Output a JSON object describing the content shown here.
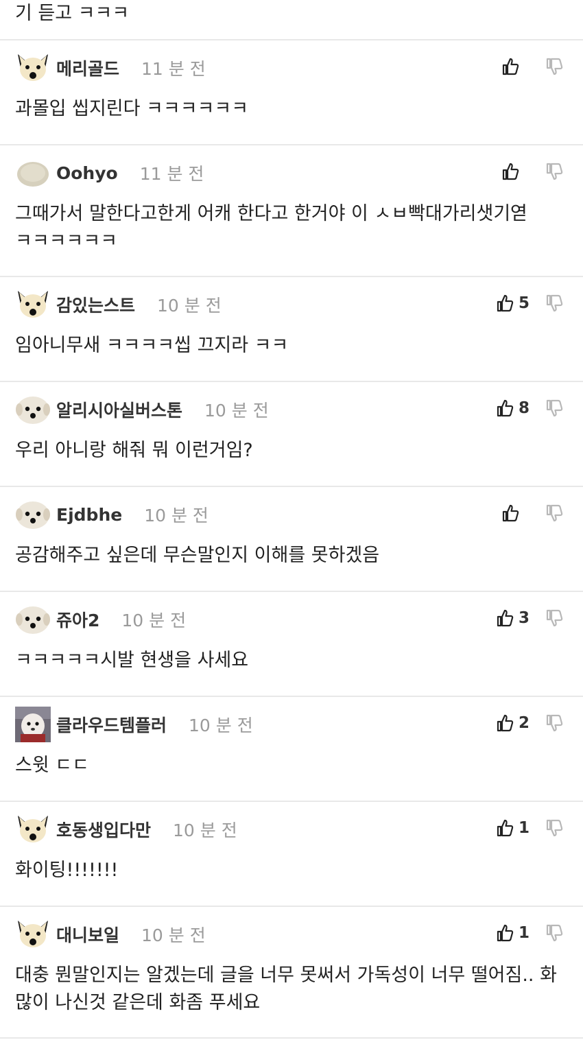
{
  "top_fragment_text": "기 듣고 ㅋㅋㅋ",
  "comments": [
    {
      "author": "메리골드",
      "time": "11 분 전",
      "likes": "",
      "text": "과몰입 씹지린다 ㅋㅋㅋㅋㅋㅋ",
      "avatar": "shiba"
    },
    {
      "author": "Oohyo",
      "time": "11 분 전",
      "likes": "",
      "text": "그때가서 말한다고한게 어캐 한다고 한거야 이 ㅅㅂ빡대가리샛기엳 ㅋㅋㅋㅋㅋㅋ",
      "avatar": "blob"
    },
    {
      "author": "감있는스트",
      "time": "10 분 전",
      "likes": "5",
      "text": "임아니무새 ㅋㅋㅋㅋ씹 끄지라 ㅋㅋ",
      "avatar": "shiba"
    },
    {
      "author": "알리시아실버스톤",
      "time": "10 분 전",
      "likes": "8",
      "text": "우리 아니랑 해줘 뭐 이런거임?",
      "avatar": "fluffy"
    },
    {
      "author": "Ejdbhe",
      "time": "10 분 전",
      "likes": "",
      "text": "공감해주고 싶은데 무슨말인지 이해를 못하겠음",
      "avatar": "fluffy"
    },
    {
      "author": "쥬아2",
      "time": "10 분 전",
      "likes": "3",
      "text": "ㅋㅋㅋㅋㅋ시발 현생을 사세요",
      "avatar": "fluffy"
    },
    {
      "author": "클라우드템플러",
      "time": "10 분 전",
      "likes": "2",
      "text": "스윗 ㄷㄷ",
      "avatar": "photo"
    },
    {
      "author": "호동생입다만",
      "time": "10 분 전",
      "likes": "1",
      "text": "화이팅!!!!!!!",
      "avatar": "shiba"
    },
    {
      "author": "대니보일",
      "time": "10 분 전",
      "likes": "1",
      "text": "대충 뭔말인지는 알겠는데 글을 너무 못써서 가독성이 너무 떨어짐.. 화 많이 나신것 같은데 화좀 푸세요",
      "avatar": "shiba"
    }
  ],
  "colors": {
    "divider": "#e8e8e8",
    "author": "#333333",
    "time": "#9a9a9a",
    "body": "#222222",
    "dislike_icon": "#b8b8b8"
  },
  "icons": {
    "like": "thumbs-up-icon",
    "dislike": "thumbs-down-icon"
  }
}
